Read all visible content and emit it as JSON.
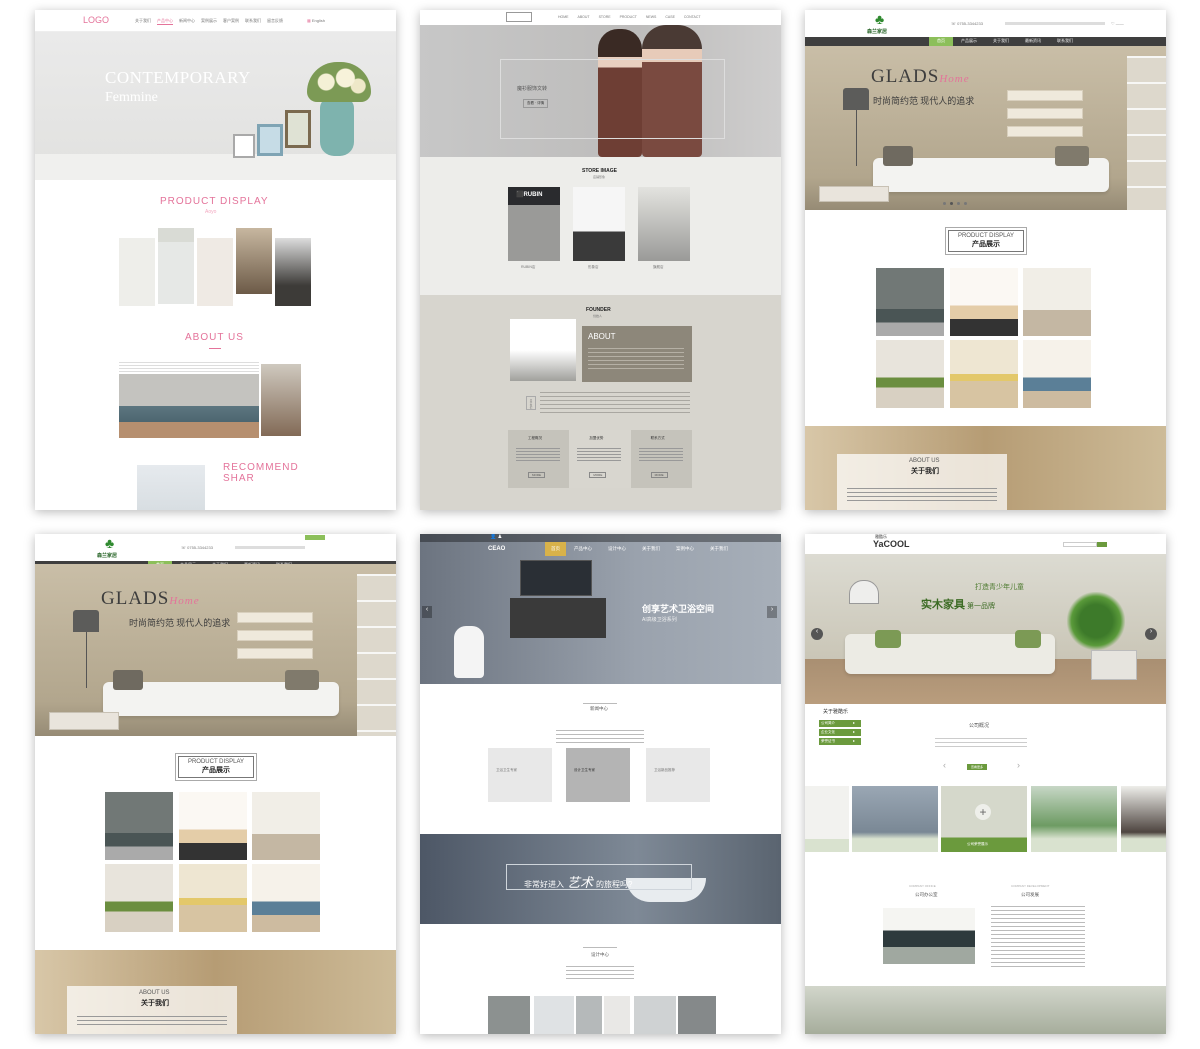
{
  "colors": {
    "pink": "#e4739a",
    "olive": "#6b9a3d",
    "nav_dark": "#3f3f3f",
    "nav_active_green": "#8cbf5a",
    "taupe": "#8d877a",
    "gray_bg": "#d6d4cd"
  },
  "t1": {
    "logo": "LOGO",
    "nav": [
      "关于我们",
      "产品中心",
      "新闻中心",
      "案例展示",
      "客户案例",
      "联系我们",
      "留言反馈"
    ],
    "lang": "English",
    "hero_title": "CONTEMPORARY",
    "hero_sub": "Femmine",
    "product_title": "PRODUCT DISPLAY",
    "product_sub": "Aoyo",
    "about_title": "ABOUT US",
    "recommend_1": "RECOMMEND",
    "recommend_2": "SHAR"
  },
  "t2": {
    "nav": [
      "HOME",
      "ABOUT",
      "STORE",
      "PRODUCT",
      "NEWS",
      "CASE",
      "CONTACT"
    ],
    "hero_text": "魔衫服饰文转",
    "hero_btn": "查看 · 详情",
    "store_title": "STORE IMAGE",
    "store_sub": "店铺形象",
    "store_captions": [
      "RUBIN店",
      "形象店",
      "旗舰店"
    ],
    "founder_title": "FOUNDER",
    "founder_sub": "创始人",
    "about_title": "ABOUT",
    "side_label": "关于我们",
    "cols": [
      {
        "title": "工程概况",
        "btn": "MORE"
      },
      {
        "title": "加盟优势",
        "btn": "MORE"
      },
      {
        "title": "联系方式",
        "btn": "MORE"
      }
    ]
  },
  "t3": {
    "logo_text": "森兰家居",
    "phone": "0755-3344233",
    "nav": [
      "首页",
      "产品展示",
      "关于我们",
      "最新资讯",
      "联系我们"
    ],
    "hero_title": "GLADS",
    "hero_script": "Home",
    "hero_sub": "时尚简约范 现代人的追求",
    "product_en": "PRODUCT DISPLAY",
    "product_cn": "产品展示",
    "about_en": "ABOUT US",
    "about_cn": "关于我们"
  },
  "t4": {
    "logo_text": "森兰家居",
    "phone": "0755-3344233",
    "nav": [
      "首页",
      "产品展示",
      "关于我们",
      "最新资讯",
      "联系我们"
    ],
    "hero_title": "GLADS",
    "hero_script": "Home",
    "hero_sub": "时尚简约范 现代人的追求",
    "product_en": "PRODUCT DISPLAY",
    "product_cn": "产品展示",
    "about_en": "ABOUT US",
    "about_cn": "关于我们"
  },
  "t5": {
    "logo": "CEAO",
    "nav": [
      "首页",
      "产品中心",
      "设计中心",
      "关于我们",
      "案例中心",
      "关于我们"
    ],
    "hero_title": "创享艺术卫浴空间",
    "hero_sub": "AI高级卫浴系列",
    "news_title": "新闻中心",
    "banner_text": "非常好进入艺术的旅程吗?",
    "banner_big": "艺术",
    "design_title": "设计中心",
    "cards": [
      "卫浴卫生专家",
      "设计卫生专家",
      "卫浴新品推荐"
    ]
  },
  "t6": {
    "logo": "YaCOOL",
    "logo_cn": "雅酷乐",
    "nav": [
      "网站首页",
      "关于我们",
      "产品展示",
      "新闻中心",
      "成功案例",
      "在线留言",
      "联系我们",
      "人才招聘"
    ],
    "hero_l1": "打造青少年儿童",
    "hero_l2": "实木家具",
    "hero_l3": "第一品牌",
    "side_title": "关于雅酷乐",
    "side_items": [
      "公司简介",
      "企业文化",
      "荣誉证书"
    ],
    "about_title": "公司概况",
    "about_btn": "查看更多",
    "photo_caption": "公司荣誉展示",
    "office_en": "COMPANY OFFICE",
    "office_cn": "公司办公室",
    "dev_en": "COMPANY DEVELOPMENT",
    "dev_cn": "公司发展"
  }
}
